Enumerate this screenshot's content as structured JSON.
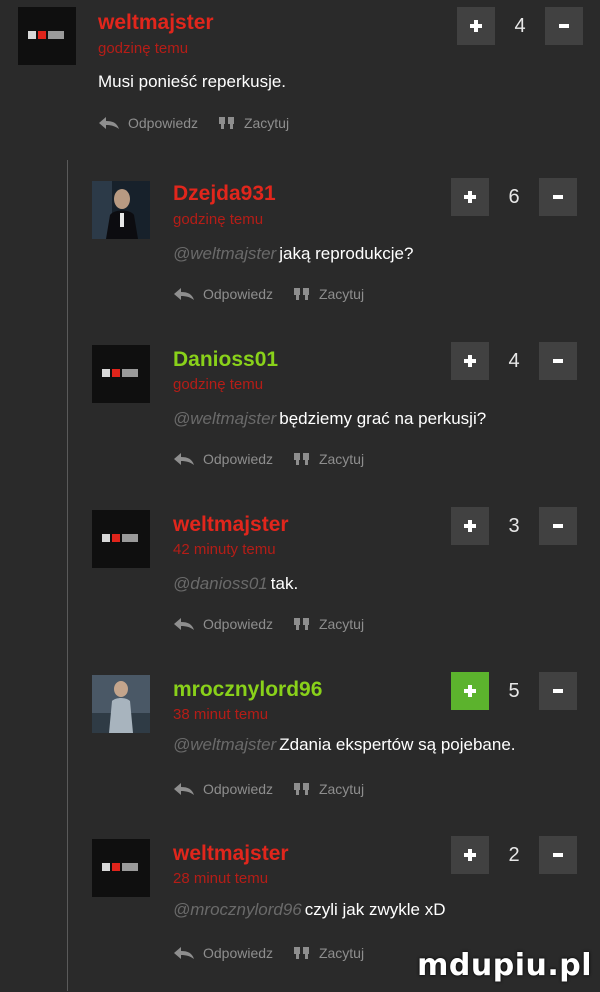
{
  "comments": [
    {
      "username": "weltmajster",
      "time": "godzinę temu",
      "mention": "",
      "text": "Musi ponieść reperkusje.",
      "votes": "4",
      "reply_label": "Odpowiedz",
      "quote_label": "Zacytuj",
      "username_color": "#e1261c"
    },
    {
      "username": "Dzejda931",
      "time": "godzinę temu",
      "mention": "@weltmajster",
      "text": "jaką reprodukcje?",
      "votes": "6",
      "reply_label": "Odpowiedz",
      "quote_label": "Zacytuj",
      "username_color": "#e1261c"
    },
    {
      "username": "Danioss01",
      "time": "godzinę temu",
      "mention": "@weltmajster",
      "text": "będziemy grać na perkusji?",
      "votes": "4",
      "reply_label": "Odpowiedz",
      "quote_label": "Zacytuj",
      "username_color": "#89d11a"
    },
    {
      "username": "weltmajster",
      "time": "42 minuty temu",
      "mention": "@danioss01",
      "text": "tak.",
      "votes": "3",
      "reply_label": "Odpowiedz",
      "quote_label": "Zacytuj",
      "username_color": "#e1261c"
    },
    {
      "username": "mrocznylord96",
      "time": "38 minut temu",
      "mention": "@weltmajster",
      "text": "Zdania ekspertów są pojebane.",
      "votes": "5",
      "reply_label": "Odpowiedz",
      "quote_label": "Zacytuj",
      "username_color": "#89d11a",
      "upvoted": true
    },
    {
      "username": "weltmajster",
      "time": "28 minut temu",
      "mention": "@mrocznylord96",
      "text": "czyli jak zwykle xD",
      "votes": "2",
      "reply_label": "Odpowiedz",
      "quote_label": "Zacytuj",
      "username_color": "#e1261c"
    }
  ],
  "icons": {
    "upvote": "plus-icon",
    "downvote": "minus-icon",
    "reply": "reply-arrow-icon",
    "quote": "quote-icon"
  },
  "colors": {
    "background": "#2a2a2a",
    "vote_button": "#414141",
    "vote_active": "#5cb32d",
    "time_text": "#b51d17",
    "action_text": "#8e8e8e"
  },
  "watermark": "mdupiu.pl"
}
